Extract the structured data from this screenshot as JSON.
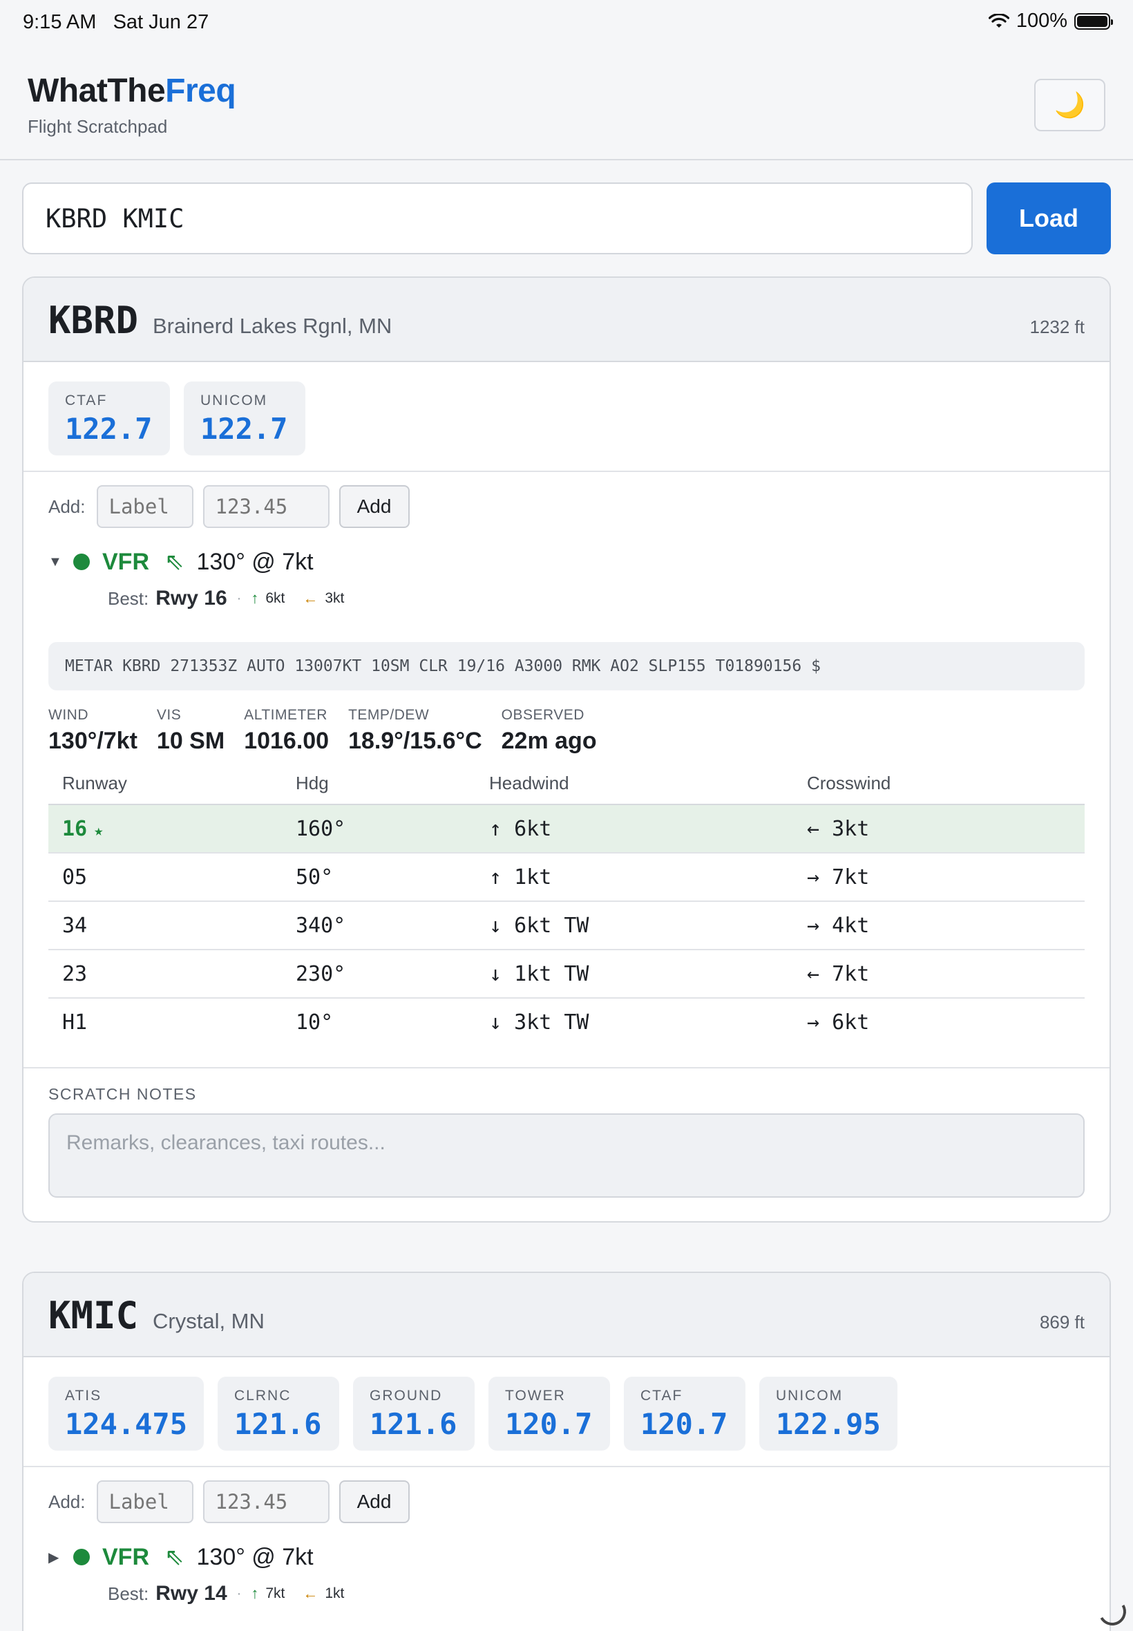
{
  "status_bar": {
    "time": "9:15 AM",
    "date": "Sat Jun 27",
    "battery": "100%"
  },
  "header": {
    "brand_part1": "WhatThe",
    "brand_part2": "Freq",
    "subtitle": "Flight Scratchpad",
    "theme_icon": "🌙"
  },
  "search": {
    "value": "KBRD KMIC",
    "load_label": "Load"
  },
  "add_form": {
    "label": "Add:",
    "label_placeholder": "Label",
    "freq_placeholder": "123.45",
    "button": "Add"
  },
  "airports": [
    {
      "icao": "KBRD",
      "name": "Brainerd Lakes Rgnl, MN",
      "elevation": "1232 ft",
      "freqs": [
        {
          "label": "CTAF",
          "value": "122.7"
        },
        {
          "label": "UNICOM",
          "value": "122.7"
        }
      ],
      "weather": {
        "expanded_icon": "▼",
        "category": "VFR",
        "wind_arrow": "⇖",
        "wind": "130° @ 7kt",
        "best_label": "Best:",
        "best_runway": "Rwy 16",
        "sep": "·",
        "head_arrow": "↑",
        "headwind": "6kt",
        "cross_arrow": "←",
        "crosswind": "3kt",
        "metar": "METAR KBRD 271353Z AUTO 13007KT 10SM CLR 19/16 A3000 RMK AO2 SLP155 T01890156 $",
        "obs": [
          {
            "label": "WIND",
            "value": "130°/7kt"
          },
          {
            "label": "VIS",
            "value": "10 SM"
          },
          {
            "label": "ALTIMETER",
            "value": "1016.00"
          },
          {
            "label": "TEMP/DEW",
            "value": "18.9°/15.6°C"
          },
          {
            "label": "OBSERVED",
            "value": "22m ago"
          }
        ],
        "table_headers": [
          "Runway",
          "Hdg",
          "Headwind",
          "Crosswind"
        ],
        "runways": [
          {
            "id": "16",
            "star": "★",
            "hdg": "160°",
            "head": "↑ 6kt",
            "cross": "← 3kt"
          },
          {
            "id": "05",
            "star": "",
            "hdg": "50°",
            "head": "↑ 1kt",
            "cross": "→ 7kt"
          },
          {
            "id": "34",
            "star": "",
            "hdg": "340°",
            "head": "↓ 6kt TW",
            "cross": "→ 4kt"
          },
          {
            "id": "23",
            "star": "",
            "hdg": "230°",
            "head": "↓ 1kt TW",
            "cross": "← 7kt"
          },
          {
            "id": "H1",
            "star": "",
            "hdg": "10°",
            "head": "↓ 3kt TW",
            "cross": "→ 6kt"
          }
        ]
      },
      "notes_label": "SCRATCH NOTES",
      "notes_placeholder": "Remarks, clearances, taxi routes..."
    },
    {
      "icao": "KMIC",
      "name": "Crystal, MN",
      "elevation": "869 ft",
      "freqs": [
        {
          "label": "ATIS",
          "value": "124.475"
        },
        {
          "label": "CLRNC",
          "value": "121.6"
        },
        {
          "label": "GROUND",
          "value": "121.6"
        },
        {
          "label": "TOWER",
          "value": "120.7"
        },
        {
          "label": "CTAF",
          "value": "120.7"
        },
        {
          "label": "UNICOM",
          "value": "122.95"
        }
      ],
      "weather": {
        "expanded_icon": "▶",
        "category": "VFR",
        "wind_arrow": "⇖",
        "wind": "130° @ 7kt",
        "best_label": "Best:",
        "best_runway": "Rwy 14",
        "sep": "·",
        "head_arrow": "↑",
        "headwind": "7kt",
        "cross_arrow": "←",
        "crosswind": "1kt"
      }
    }
  ],
  "colors": {
    "accent": "#1a6fd8",
    "vfr": "#1d8a3c",
    "crosswind": "#c98100",
    "best_row": "#e6f1e8"
  }
}
